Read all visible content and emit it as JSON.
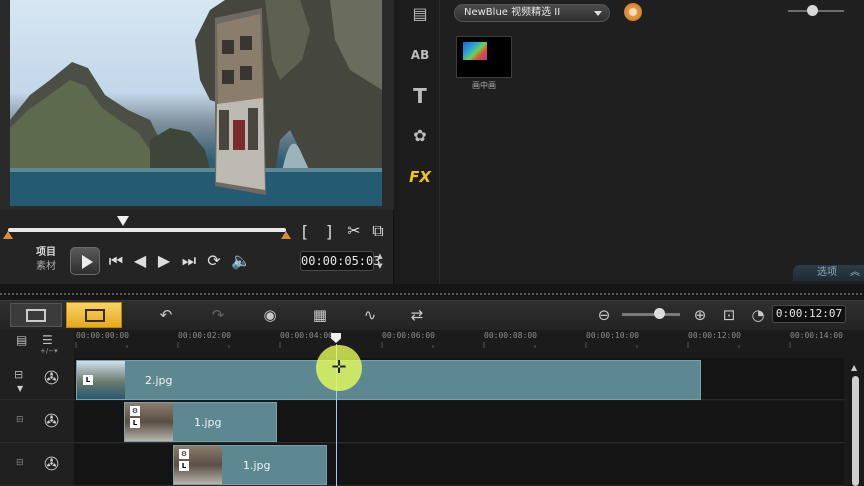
{
  "library": {
    "filter_label": "NewBlue 视频精选 II",
    "thumbnail_label": "画中画",
    "options_label": "选项",
    "tabs": [
      "media-icon",
      "title-ab-icon",
      "text-t-icon",
      "transition-icon",
      "fx-icon"
    ],
    "fx_label": "FX"
  },
  "preview": {
    "mode_project": "项目",
    "mode_clip": "素材",
    "timecode": "00:00:05:03",
    "trim_in": "[",
    "trim_out": "]"
  },
  "toolbar": {
    "duration": "0:00:12:07"
  },
  "ruler": {
    "ticks": [
      "00:00:00:00",
      "00:00:02:00",
      "00:00:04:00",
      "00:00:06:00",
      "00:00:08:00",
      "00:00:10:00",
      "00:00:12:00",
      "00:00:14:00"
    ]
  },
  "tracks": [
    {
      "type": "video",
      "clips": [
        {
          "name": "2.jpg"
        }
      ]
    },
    {
      "type": "overlay",
      "clips": [
        {
          "name": "1.jpg"
        }
      ]
    },
    {
      "type": "overlay",
      "clips": [
        {
          "name": "1.jpg"
        }
      ]
    }
  ],
  "colors": {
    "accent": "#e5a91b",
    "clip": "#5d8891",
    "fx": "#f0c419",
    "trim": "#e08c2c"
  }
}
